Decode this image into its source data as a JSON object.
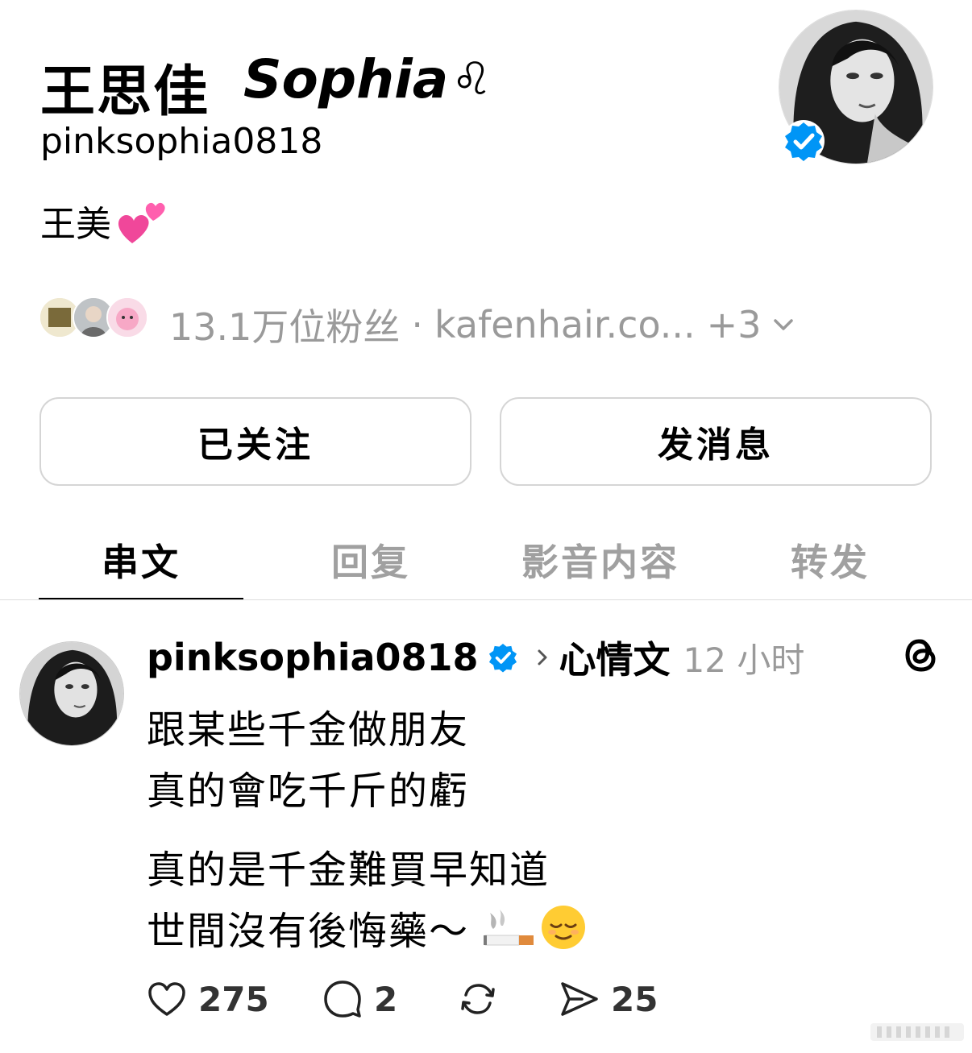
{
  "profile": {
    "display_name_cn": "王思佳",
    "display_name_latin": "Sophia",
    "zodiac": "♌︎",
    "username": "pinksophia0818",
    "bio": "王美",
    "bio_emoji": "two-hearts-icon"
  },
  "followers": {
    "count_text": "13.1万位粉丝",
    "separator": "·",
    "link_text": "kafenhair.co...",
    "more_text": "+3"
  },
  "buttons": {
    "follow_label": "已关注",
    "message_label": "发消息"
  },
  "tabs": [
    {
      "label": "串文",
      "active": true
    },
    {
      "label": "回复",
      "active": false
    },
    {
      "label": "影音内容",
      "active": false
    },
    {
      "label": "转发",
      "active": false
    }
  ],
  "post": {
    "username": "pinksophia0818",
    "topic": "心情文",
    "time": "12 小时",
    "lines": [
      "跟某些千金做朋友",
      "真的會吃千斤的虧",
      "真的是千金難買早知道",
      "世間沒有後悔藥～"
    ],
    "emojis": [
      "cigarette-icon",
      "relieved-face-icon"
    ],
    "likes": "275",
    "replies": "2",
    "shares": "25"
  },
  "colors": {
    "verified_blue": "#0095f6",
    "secondary_gray": "#9a9a9a",
    "border_gray": "#d5d5d5"
  }
}
